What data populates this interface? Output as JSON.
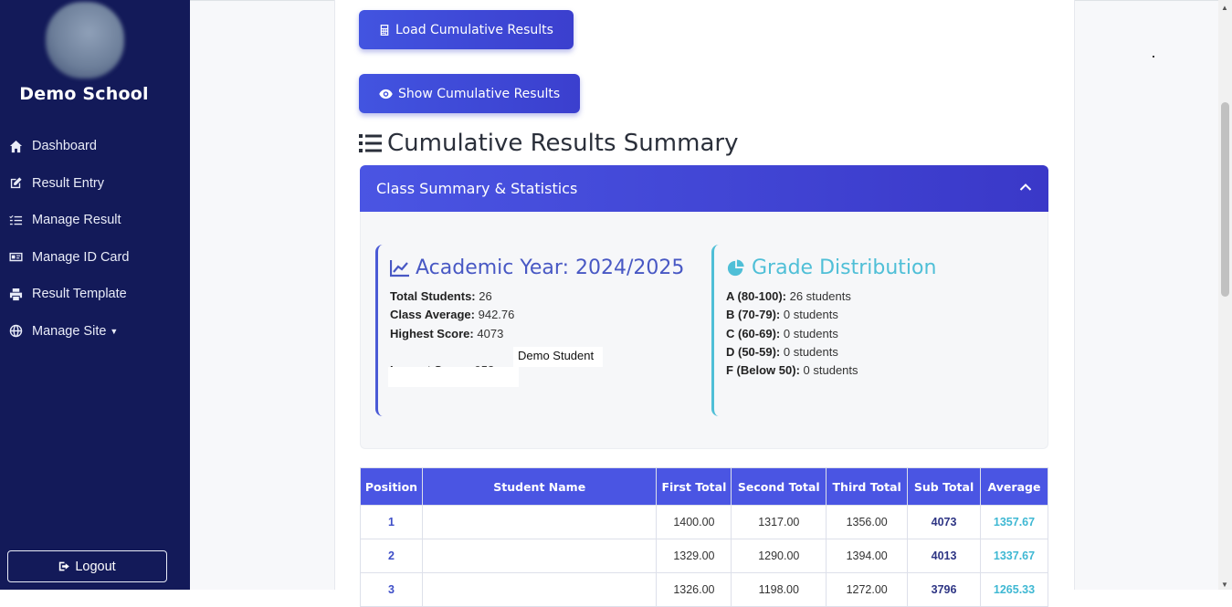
{
  "sidebar": {
    "school_name": "Demo School",
    "items": [
      {
        "label": "Dashboard",
        "icon": "home-icon"
      },
      {
        "label": "Result Entry",
        "icon": "edit-icon"
      },
      {
        "label": "Manage Result",
        "icon": "list-check-icon"
      },
      {
        "label": "Manage ID Card",
        "icon": "id-card-icon"
      },
      {
        "label": "Result Template",
        "icon": "print-icon"
      },
      {
        "label": "Manage Site",
        "icon": "globe-icon"
      }
    ],
    "logout_label": "Logout"
  },
  "actions": {
    "load_label": "Load Cumulative Results",
    "show_label": "Show Cumulative Results"
  },
  "summary": {
    "title": "Cumulative Results Summary",
    "panel_title": "Class Summary & Statistics",
    "academic": {
      "title": "Academic Year: 2024/2025",
      "total_students_label": "Total Students:",
      "total_students": "26",
      "class_average_label": "Class Average:",
      "class_average": "942.76",
      "highest_label": "Highest Score:",
      "highest": "4073",
      "highest_name": "Demo Student",
      "lowest_label": "Lowest Score:",
      "lowest": "958"
    },
    "grades": {
      "title": "Grade Distribution",
      "rows": [
        {
          "label": "A (80-100):",
          "value": "26 students"
        },
        {
          "label": "B (70-79):",
          "value": "0 students"
        },
        {
          "label": "C (60-69):",
          "value": "0 students"
        },
        {
          "label": "D (50-59):",
          "value": "0 students"
        },
        {
          "label": "F (Below 50):",
          "value": "0 students"
        }
      ]
    }
  },
  "table": {
    "headers": [
      "Position",
      "Student Name",
      "First Total",
      "Second Total",
      "Third Total",
      "Sub Total",
      "Average"
    ],
    "rows": [
      {
        "position": "1",
        "name": "",
        "first": "1400.00",
        "second": "1317.00",
        "third": "1356.00",
        "sub": "4073",
        "avg": "1357.67"
      },
      {
        "position": "2",
        "name": "",
        "first": "1329.00",
        "second": "1290.00",
        "third": "1394.00",
        "sub": "4013",
        "avg": "1337.67"
      },
      {
        "position": "3",
        "name": "",
        "first": "1326.00",
        "second": "1198.00",
        "third": "1272.00",
        "sub": "3796",
        "avg": "1265.33"
      }
    ]
  },
  "colors": {
    "sidebar_bg": "#131a59",
    "accent": "#4a55e3",
    "teal": "#4fbfd7"
  }
}
